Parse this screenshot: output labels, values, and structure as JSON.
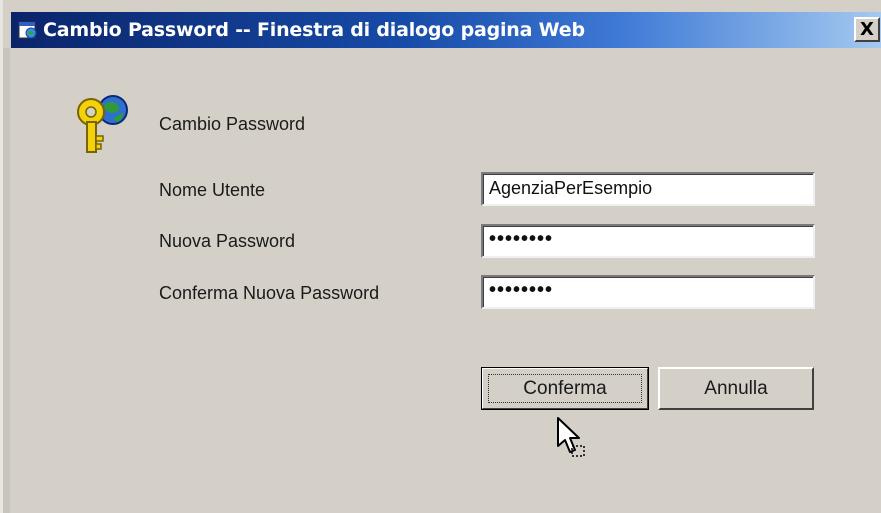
{
  "window": {
    "title": "Cambio Password -- Finestra di dialogo pagina Web",
    "close_label": "X"
  },
  "dialog": {
    "header": "Cambio Password",
    "fields": [
      {
        "label": "Nome Utente",
        "value": "AgenziaPerEsempio"
      },
      {
        "label": "Nuova Password",
        "value": "••••••••"
      },
      {
        "label": "Conferma Nuova Password",
        "value": "••••••••"
      }
    ],
    "buttons": {
      "confirm_label": "Conferma",
      "cancel_label": "Annulla"
    }
  },
  "icons": {
    "dialog_icon": "key-globe-icon",
    "title_icon": "web-dialog-icon",
    "cursor": "mouse-pointer-icon"
  },
  "colors": {
    "titlebar_start": "#0a246a",
    "titlebar_end": "#a6caf0",
    "dialog_bg": "#d4d0c8"
  }
}
